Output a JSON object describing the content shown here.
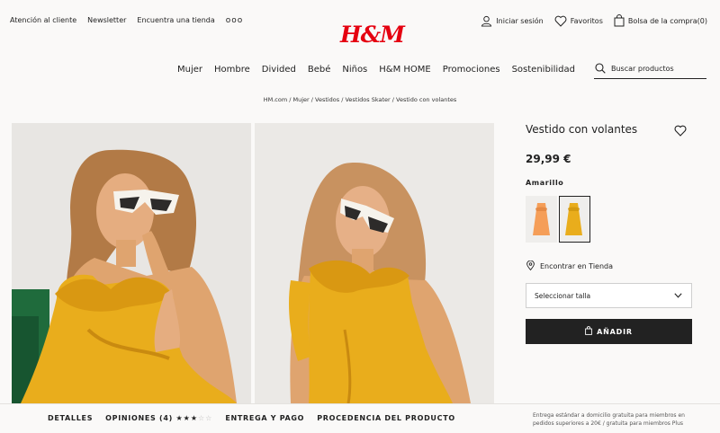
{
  "header": {
    "top_links": [
      "Atención al cliente",
      "Newsletter",
      "Encuentra una tienda"
    ],
    "more_icon": "ooo",
    "logo_text": "H&M",
    "account": {
      "login": "Iniciar sesión",
      "favorites": "Favoritos",
      "cart": "Bolsa de la compra",
      "cart_count": "(0)"
    }
  },
  "nav": {
    "items": [
      "Mujer",
      "Hombre",
      "Divided",
      "Bebé",
      "Niños",
      "H&M HOME",
      "Promociones",
      "Sostenibilidad"
    ],
    "search_placeholder": "Buscar productos"
  },
  "breadcrumb": "HM.com / Mujer / Vestidos / Vestidos Skater / Vestido con volantes",
  "product": {
    "title": "Vestido con volantes",
    "price": "29,99 €",
    "color": "Amarillo",
    "find_in_store": "Encontrar en Tienda",
    "size_select": "Seleccionar talla",
    "add_button": "AÑADIR"
  },
  "bottom_tabs": {
    "details": "DETALLES",
    "reviews": "OPINIONES (4)",
    "rating": 3,
    "rating_max": 5,
    "shipping": "ENTREGA Y PAGO",
    "origin": "PROCEDENCIA DEL PRODUCTO"
  },
  "shipping_note": "Entrega estándar a domicilio gratuita para miembros en pedidos superiores a 20€ / gratuita para miembros Plus",
  "colors": {
    "brand_red": "#e50010",
    "button_black": "#222222",
    "dress_yellow": "#e9ad1c",
    "swatch_orange": "#f59e58"
  }
}
